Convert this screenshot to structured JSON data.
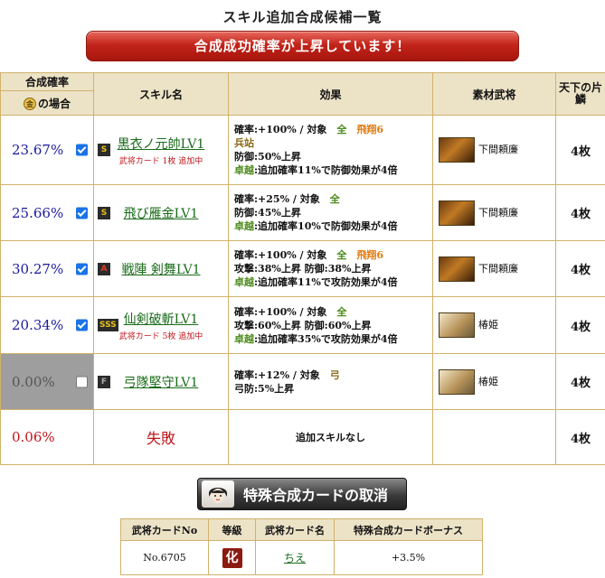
{
  "page_title": "スキル追加合成候補一覧",
  "banner": "合成成功確率が上昇しています！",
  "headers": {
    "rate_top": "合成確率",
    "rate_gold_badge": "金",
    "rate_gold": "の場合",
    "skill": "スキル名",
    "effect": "効果",
    "material": "素材武将",
    "tenka": "天下の片鱗"
  },
  "rows": [
    {
      "rate": "23.67%",
      "rank": "S",
      "skill": "黒衣ノ元帥LV1",
      "sub": "武将カード 1枚 追加中",
      "effect": [
        "確率:+100% / 対象",
        "全",
        "飛翔6",
        "兵站",
        "防御:50%上昇",
        "卓越",
        ":追加確率11%で防御効果が4倍"
      ],
      "general": "下間頼廉",
      "count": "4枚"
    },
    {
      "rate": "25.66%",
      "rank": "S",
      "skill": "飛び雁金LV1",
      "sub": "",
      "effect": [
        "確率:+25% / 対象",
        "全",
        "防御:45%上昇",
        "卓越",
        ":追加確率10%で防御効果が4倍"
      ],
      "general": "下間頼廉",
      "count": "4枚"
    },
    {
      "rate": "30.27%",
      "rank": "A",
      "skill": "戦陣 剣舞LV1",
      "sub": "",
      "effect": [
        "確率:+100% / 対象",
        "全",
        "飛翔6",
        "攻撃:38%上昇 防御:38%上昇",
        "卓越",
        ":追加確率11%で攻防効果が4倍"
      ],
      "general": "下間頼廉",
      "count": "4枚"
    },
    {
      "rate": "20.34%",
      "rank": "SSS",
      "skill": "仙剣破斬LV1",
      "sub": "武将カード 5枚 追加中",
      "effect": [
        "確率:+100% / 対象",
        "全",
        "攻撃:60%上昇 防御:60%上昇",
        "卓越",
        ":追加確率35%で攻防効果が4倍"
      ],
      "general": "椿姫",
      "count": "4枚"
    },
    {
      "rate": "0.00%",
      "rank": "F",
      "skill": "弓隊堅守LV1",
      "sub": "",
      "effect": [
        "確率:+12% / 対象",
        "弓",
        "弓防:5%上昇"
      ],
      "general": "椿姫",
      "count": "4枚"
    }
  ],
  "fail_row": {
    "rate": "0.06%",
    "skill": "失敗",
    "effect": "追加スキルなし",
    "count": "4枚"
  },
  "cancel_button": "特殊合成カードの取消",
  "card_table": {
    "headers": [
      "武将カードNo",
      "等級",
      "武将カード名",
      "特殊合成カードボーナス"
    ],
    "no": "No.6705",
    "grade": "化",
    "name": "ちえ",
    "bonus": "+3.5%"
  },
  "colors": {
    "banner_red": "#c2241a",
    "header_bg": "#ece2c6",
    "border_gold": "#d1b26a",
    "rate_blue": "#1a1a9e",
    "fail_red": "#c0141a",
    "skill_green": "#1a6b1a"
  }
}
